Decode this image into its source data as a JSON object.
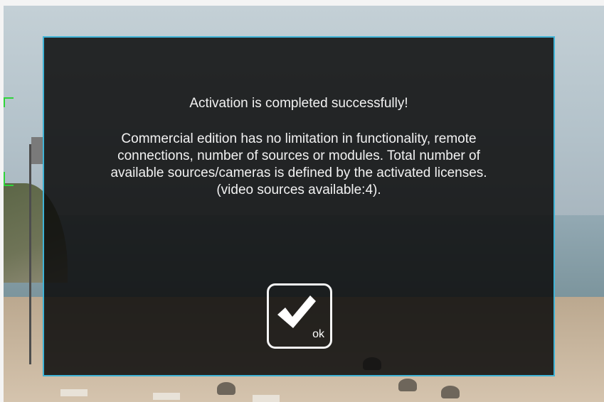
{
  "background": {
    "description_icon": "camera-feed-beach"
  },
  "dialog": {
    "title": "Activation is completed successfully!",
    "body_lines": [
      "Commercial edition has no limitation in functionality, remote",
      "connections, number of sources or modules. Total number of",
      "available sources/cameras is defined by the activated licenses.",
      "(video sources available:4)."
    ],
    "ok_button": {
      "label": "ok",
      "icon": "checkmark-icon"
    },
    "colors": {
      "border": "#3fb3d6",
      "background": "#0a0a0a",
      "text": "#f2f2f2"
    }
  }
}
